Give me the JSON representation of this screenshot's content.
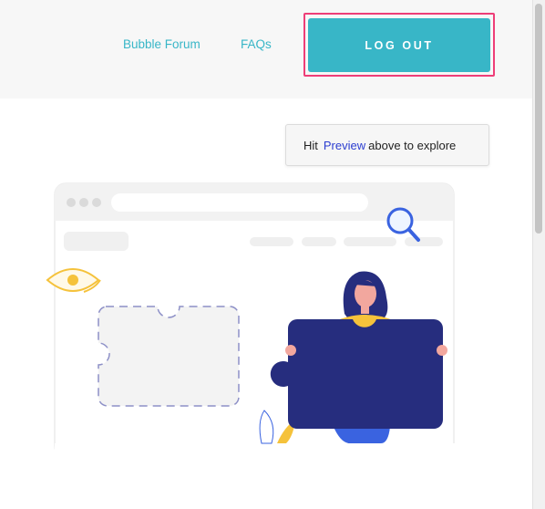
{
  "header": {
    "links": [
      {
        "label": "Bubble Forum"
      },
      {
        "label": "FAQs"
      }
    ],
    "logout_label": "LOG OUT"
  },
  "hint": {
    "prefix": "Hit",
    "link": "Preview",
    "suffix": "above to explore"
  },
  "illustration": {
    "name": "person-holding-puzzle-piece",
    "colors": {
      "accent": "#38b6c7",
      "highlight": "#ee3e78",
      "puzzle": "#262d7e",
      "yellow": "#f5c23b",
      "blue": "#3a63e0"
    }
  }
}
